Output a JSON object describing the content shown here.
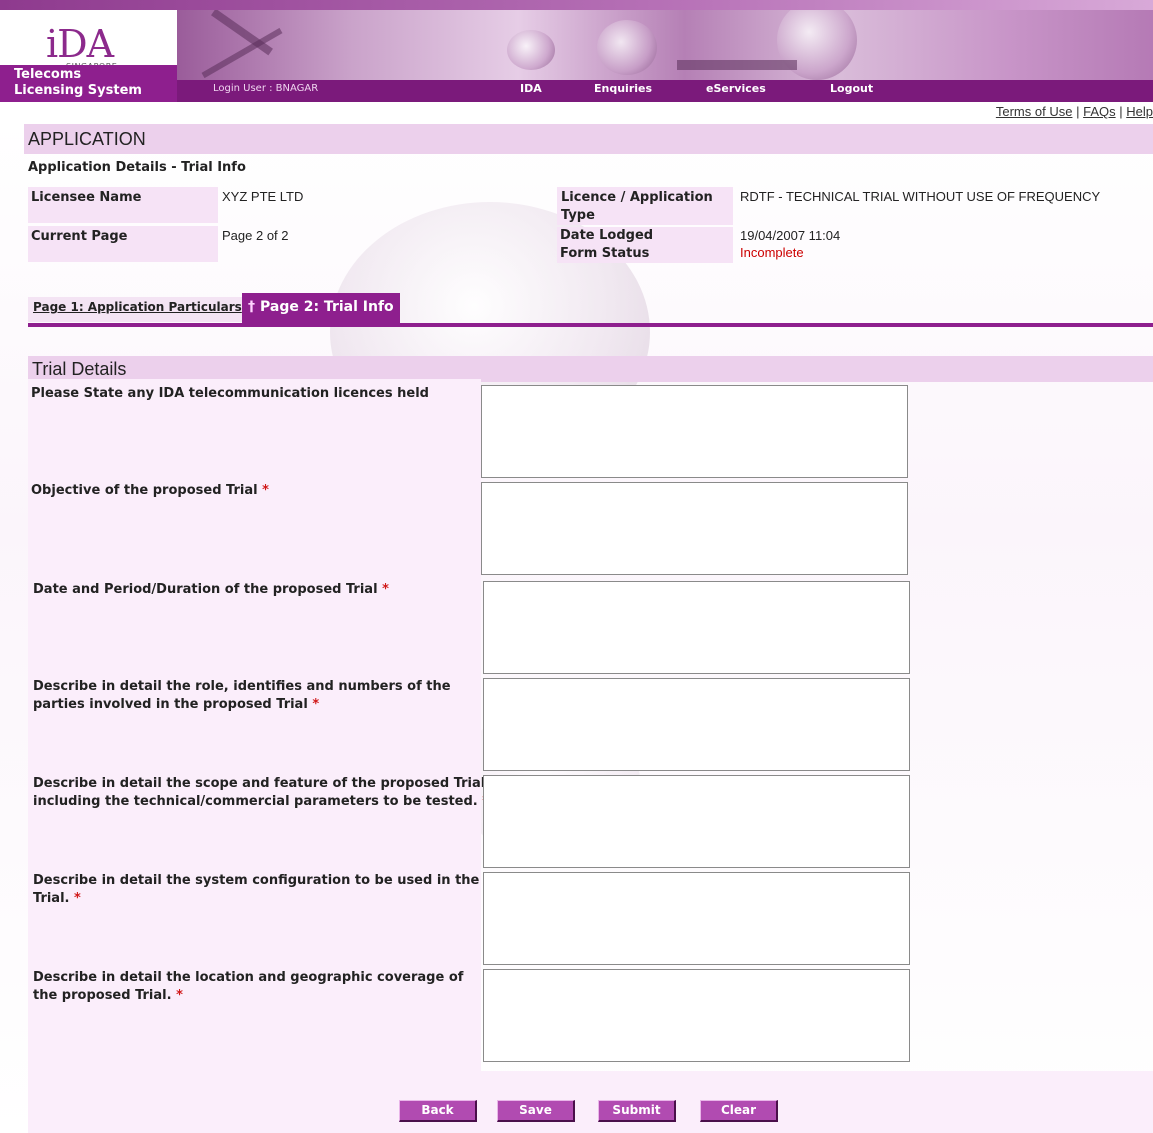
{
  "header": {
    "logo_text": "iDA",
    "logo_sub": "SINGAPORE",
    "system_line1": "Telecoms",
    "system_line2": "Licensing System",
    "login_user": "Login User : BNAGAR",
    "nav": [
      "IDA",
      "Enquiries",
      "eServices",
      "Logout"
    ]
  },
  "toplinks": {
    "terms": "Terms of Use",
    "faqs": "FAQs",
    "help": "Help",
    "sep": "|"
  },
  "application": {
    "title": "APPLICATION",
    "subtitle": "Application Details - Trial Info",
    "licensee_label": "Licensee Name",
    "licensee_value": "XYZ PTE LTD",
    "current_page_label": "Current Page",
    "current_page_value": "Page 2 of 2",
    "licence_type_label": "Licence / Application Type",
    "licence_type_value": "RDTF - TECHNICAL TRIAL WITHOUT USE OF FREQUENCY",
    "date_lodged_label": "Date Lodged",
    "date_lodged_value": "19/04/2007 11:04",
    "form_status_label": "Form Status",
    "form_status_value": "Incomplete"
  },
  "tabs": {
    "tab1": "Page 1: Application Particulars",
    "tab2": "Page 2: Trial Info",
    "tab2_marker": "†"
  },
  "trial": {
    "title": "Trial Details",
    "required_marker": "*",
    "q1": "Please State any IDA telecommunication licences held",
    "q2": "Objective of the proposed Trial",
    "q3": "Date and Period/Duration of the proposed Trial",
    "q4_line1": "Describe in detail the role, identifies and numbers of the",
    "q4_line2": "parties involved in the proposed Trial",
    "q5_line1": "Describe in detail the scope and feature of the proposed Trial,",
    "q5_line2": "including the technical/commercial parameters to be tested.",
    "q6_line1": "Describe in detail the system configuration to be used in the",
    "q6_line2": "Trial.",
    "q7_line1": "Describe in detail the location and geographic coverage of",
    "q7_line2": "the proposed Trial."
  },
  "buttons": {
    "back": "Back",
    "save": "Save",
    "submit": "Submit",
    "clear": "Clear"
  },
  "colors": {
    "brand": "#8e1f8e",
    "section_bg": "#ecd0ec",
    "required": "#d01818"
  }
}
